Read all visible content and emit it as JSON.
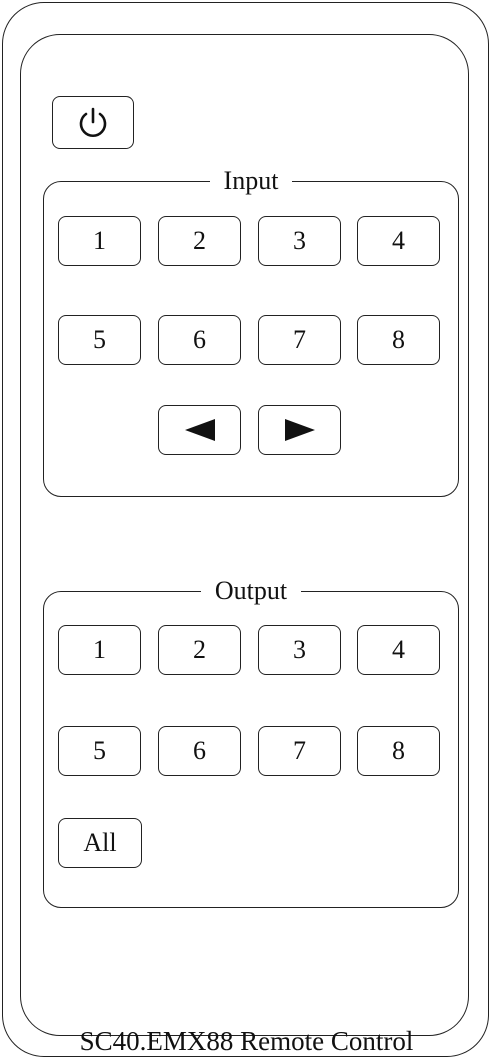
{
  "power_button": {
    "icon": "power-icon"
  },
  "input_group": {
    "title": "Input",
    "buttons": [
      "1",
      "2",
      "3",
      "4",
      "5",
      "6",
      "7",
      "8"
    ],
    "prev_icon": "left-triangle-icon",
    "next_icon": "right-triangle-icon"
  },
  "output_group": {
    "title": "Output",
    "buttons": [
      "1",
      "2",
      "3",
      "4",
      "5",
      "6",
      "7",
      "8"
    ],
    "all_label": "All"
  },
  "footer": {
    "label": "SC40.EMX88 Remote Control"
  }
}
